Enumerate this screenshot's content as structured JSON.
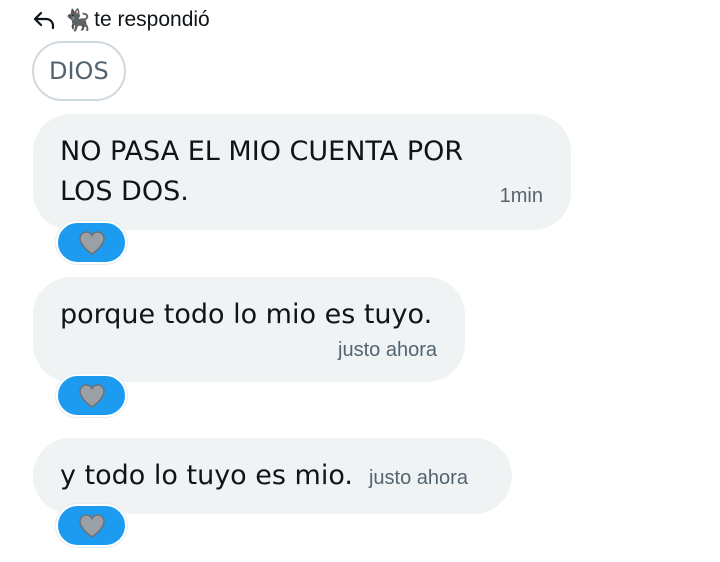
{
  "header": {
    "icon": "reply-arrow-icon",
    "emoji": "🐈‍⬛",
    "text": "te respondió"
  },
  "quoted": {
    "text": "DIOS"
  },
  "messages": [
    {
      "text": "NO PASA EL MIO CUENTA POR LOS DOS.",
      "time": "1min",
      "reaction": "🩶"
    },
    {
      "text": "porque todo lo mio es tuyo.",
      "time": "justo ahora",
      "reaction": "🩶"
    },
    {
      "text": "y todo lo tuyo es mio.",
      "time": "justo ahora",
      "reaction": "🩶"
    }
  ],
  "colors": {
    "bubble": "#eff3f4",
    "reaction": "#1d9bf0",
    "secondary_text": "#536471",
    "heart": "#9aa0a6"
  }
}
